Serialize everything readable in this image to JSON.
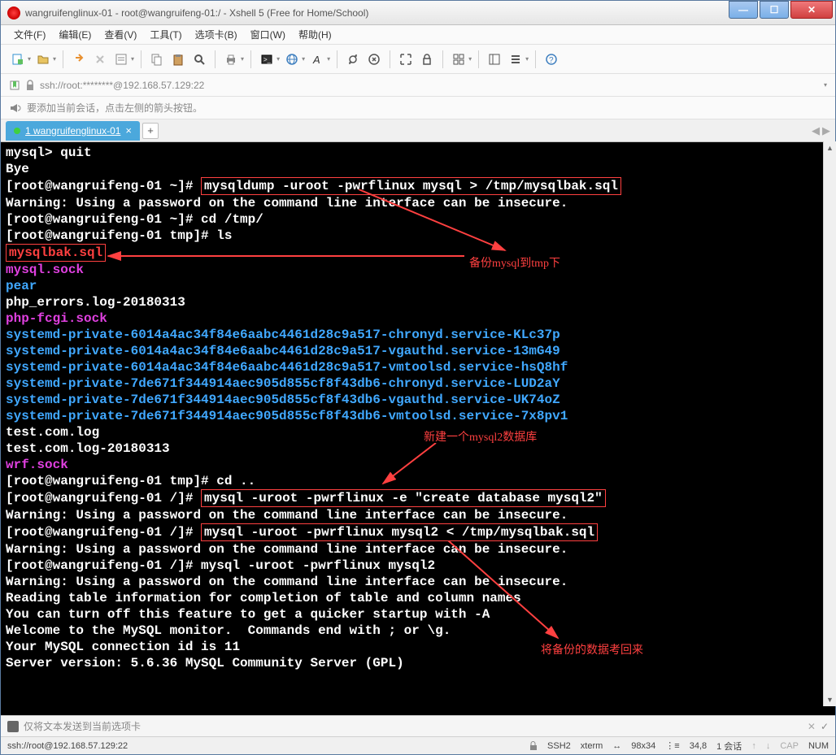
{
  "title": "wangruifenglinux-01 - root@wangruifeng-01:/ - Xshell 5 (Free for Home/School)",
  "menu": {
    "file": "文件(F)",
    "edit": "编辑(E)",
    "view": "查看(V)",
    "tools": "工具(T)",
    "tabs": "选项卡(B)",
    "window": "窗口(W)",
    "help": "帮助(H)"
  },
  "address": "ssh://root:********@192.168.57.129:22",
  "hint": "要添加当前会话，点击左侧的箭头按钮。",
  "tab": {
    "label": "1 wangruifenglinux-01"
  },
  "terminal": {
    "l1": "mysql> quit",
    "l2": "Bye",
    "l3a": "[root@wangruifeng-01 ~]# ",
    "l3b": "mysqldump -uroot -pwrflinux mysql > /tmp/mysqlbak.sql",
    "l4": "Warning: Using a password on the command line interface can be insecure.",
    "l5": "[root@wangruifeng-01 ~]# cd /tmp/",
    "l6": "[root@wangruifeng-01 tmp]# ls",
    "l7": "mysqlbak.sql",
    "l8": "mysql.sock",
    "l9": "pear",
    "l10": "php_errors.log-20180313",
    "l11": "php-fcgi.sock",
    "l12": "systemd-private-6014a4ac34f84e6aabc4461d28c9a517-chronyd.service-KLc37p",
    "l13": "systemd-private-6014a4ac34f84e6aabc4461d28c9a517-vgauthd.service-13mG49",
    "l14": "systemd-private-6014a4ac34f84e6aabc4461d28c9a517-vmtoolsd.service-hsQ8hf",
    "l15": "systemd-private-7de671f344914aec905d855cf8f43db6-chronyd.service-LUD2aY",
    "l16": "systemd-private-7de671f344914aec905d855cf8f43db6-vgauthd.service-UK74oZ",
    "l17": "systemd-private-7de671f344914aec905d855cf8f43db6-vmtoolsd.service-7x8pv1",
    "l18": "test.com.log",
    "l19": "test.com.log-20180313",
    "l20": "wrf.sock",
    "l21": "[root@wangruifeng-01 tmp]# cd ..",
    "l22a": "[root@wangruifeng-01 /]# ",
    "l22b": "mysql -uroot -pwrflinux -e \"create database mysql2\"",
    "l23": "Warning: Using a password on the command line interface can be insecure.",
    "l24a": "[root@wangruifeng-01 /]# ",
    "l24b": "mysql -uroot -pwrflinux mysql2 < /tmp/mysqlbak.sql",
    "l25": "Warning: Using a password on the command line interface can be insecure.",
    "l26": "[root@wangruifeng-01 /]# mysql -uroot -pwrflinux mysql2",
    "l27": "Warning: Using a password on the command line interface can be insecure.",
    "l28": "Reading table information for completion of table and column names",
    "l29": "You can turn off this feature to get a quicker startup with -A",
    "l30": "",
    "l31": "Welcome to the MySQL monitor.  Commands end with ; or \\g.",
    "l32": "Your MySQL connection id is 11",
    "l33": "Server version: 5.6.36 MySQL Community Server (GPL)"
  },
  "annot": {
    "a1": "备份mysql到tmp下",
    "a2": "新建一个mysql2数据库",
    "a3": "将备份的数据考回来"
  },
  "inputbar": {
    "text": "仅将文本发送到当前选项卡"
  },
  "status": {
    "left": "ssh://root@192.168.57.129:22",
    "ssh": "SSH2",
    "term": "xterm",
    "size": "98x34",
    "pos": "34,8",
    "sess": "1 会话",
    "cap": "CAP",
    "num": "NUM"
  },
  "icons": {
    "lock": "🔒",
    "bullhorn": "📢",
    "dropdown": "▾",
    "plus": "+",
    "close": "×",
    "min": "—",
    "max": "☐",
    "xclose": "✕",
    "left": "◀",
    "right": "▶",
    "up": "▲",
    "down": "▼",
    "check": "✓"
  }
}
